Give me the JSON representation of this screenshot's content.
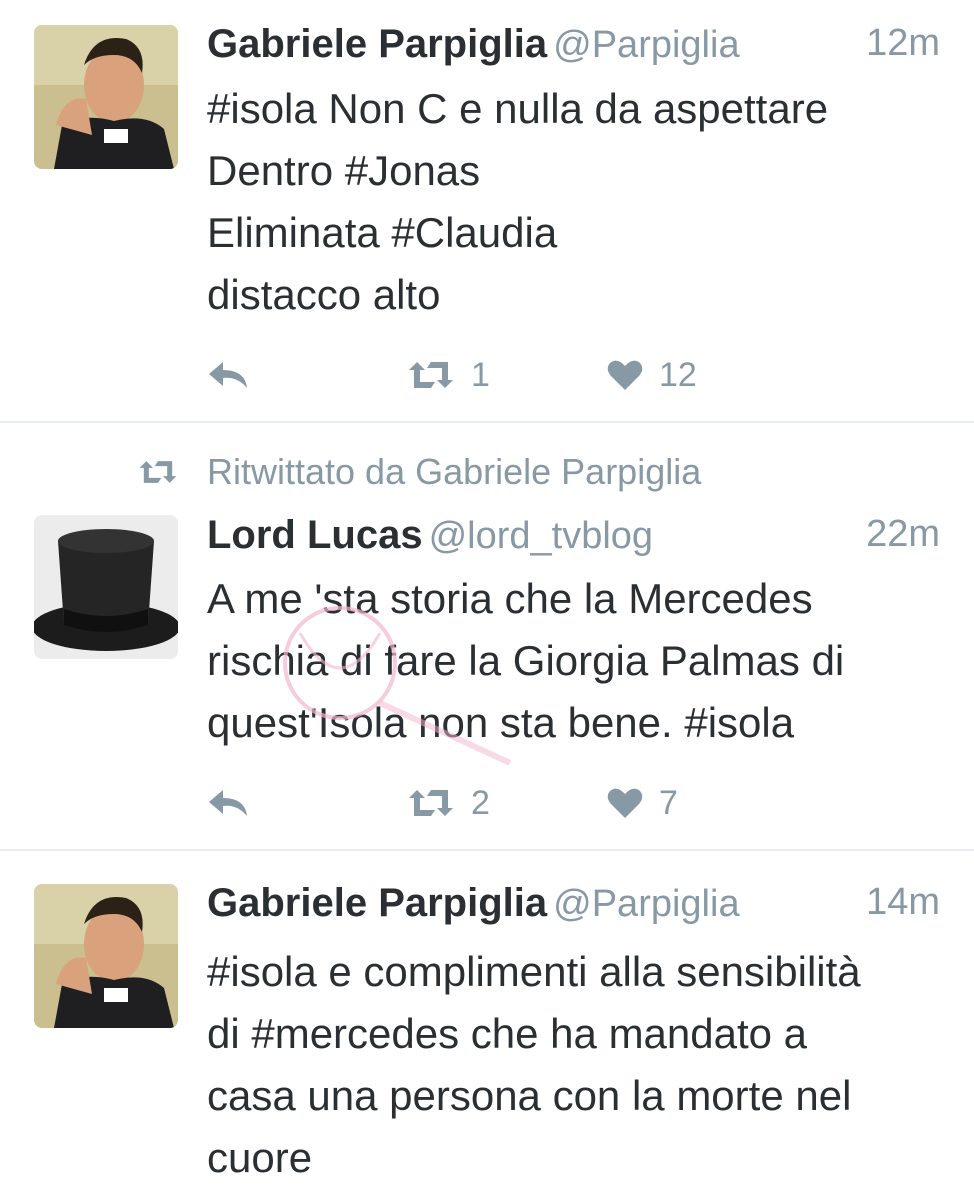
{
  "tweets": [
    {
      "name": "Gabriele Parpiglia",
      "handle": "@Parpiglia",
      "time": "12m",
      "text": "#isola Non C e nulla da aspettare\nDentro #Jonas\nEliminata #Claudia\ndistacco alto",
      "retweets": "1",
      "likes": "12"
    },
    {
      "retweeted_by": "Ritwittato da Gabriele Parpiglia",
      "name": "Lord Lucas",
      "handle": "@lord_tvblog",
      "time": "22m",
      "text": "A me 'sta storia che la Mercedes\nrischia di fare la Giorgia Palmas di\nquest'Isola non sta bene. #isola",
      "retweets": "2",
      "likes": "7"
    },
    {
      "name": "Gabriele Parpiglia",
      "handle": "@Parpiglia",
      "time": "14m",
      "text": "#isola e complimenti alla sensibilità\ndi #mercedes che ha mandato a\ncasa una persona con la morte nel\ncuore"
    }
  ],
  "colors": {
    "text": "#292f33",
    "muted": "#8899a6",
    "divider": "#e6ecf0"
  },
  "icons": {
    "reply": "reply-icon",
    "retweet": "retweet-icon",
    "like": "heart-icon"
  }
}
